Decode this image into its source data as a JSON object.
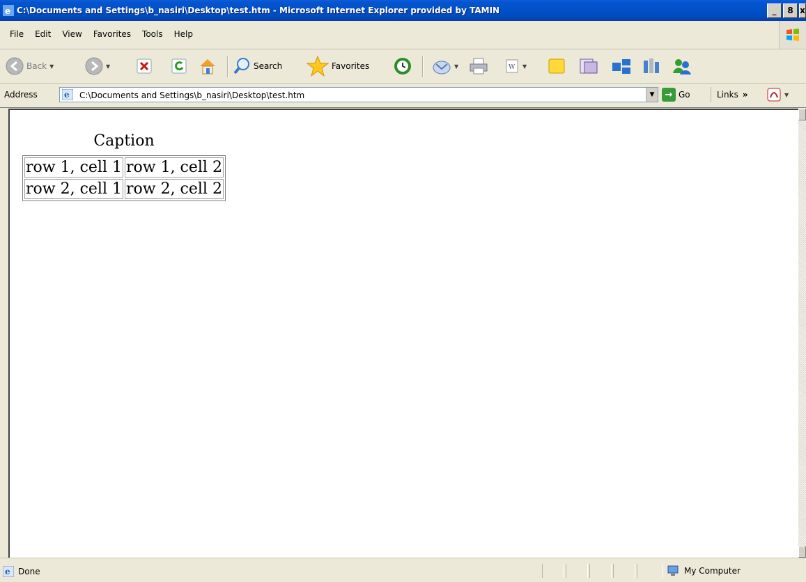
{
  "window": {
    "title": "C:\\Documents and Settings\\b_nasiri\\Desktop\\test.htm - Microsoft Internet Explorer provided by TAMIN",
    "controls": {
      "minimize": "_",
      "maximize": "8",
      "close": "x"
    }
  },
  "menu": {
    "items": [
      "File",
      "Edit",
      "View",
      "Favorites",
      "Tools",
      "Help"
    ]
  },
  "toolbar": {
    "back_label": "Back",
    "search_label": "Search",
    "favorites_label": "Favorites"
  },
  "address": {
    "label": "Address",
    "url": "C:\\Documents and Settings\\b_nasiri\\Desktop\\test.htm",
    "go_label": "Go",
    "links_label": "Links",
    "links_chevron": "»"
  },
  "page": {
    "caption": "Caption",
    "rows": [
      [
        "row 1, cell 1",
        "row 1, cell 2"
      ],
      [
        "row 2, cell 1",
        "row 2, cell 2"
      ]
    ]
  },
  "status": {
    "text": "Done",
    "zone": "My Computer"
  },
  "colors": {
    "titlebar": "#0052c8",
    "chrome": "#ece9d8",
    "content_bg": "#ffffff"
  }
}
